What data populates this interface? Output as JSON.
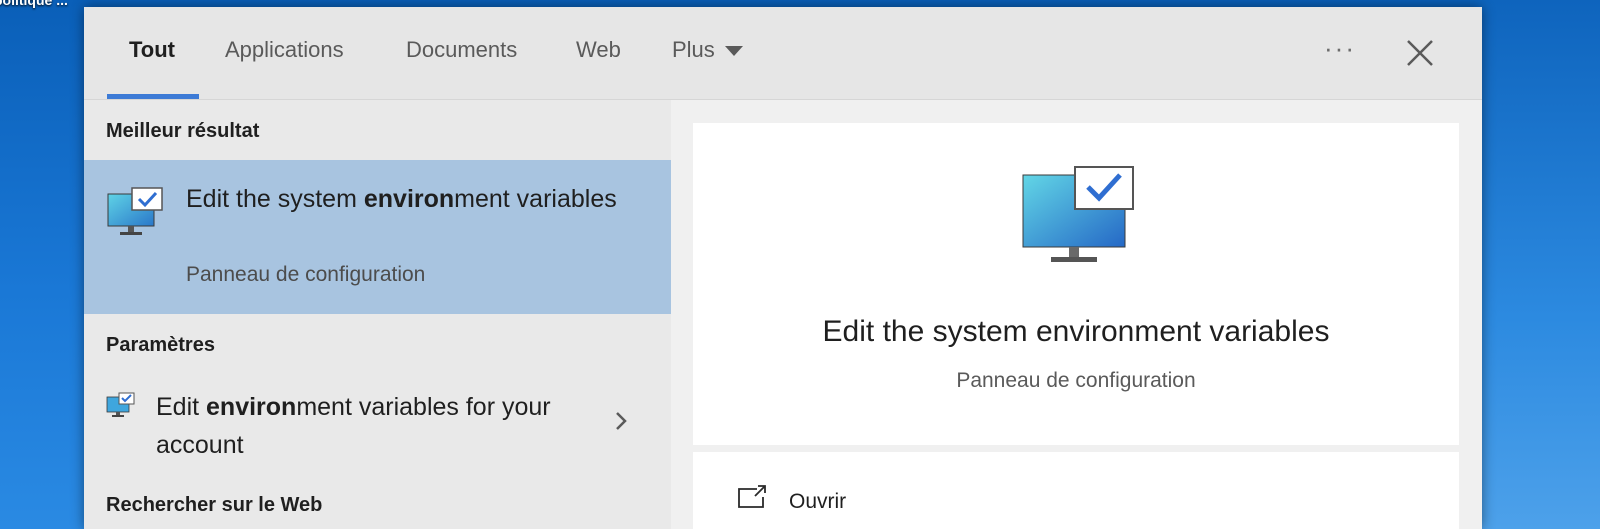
{
  "desktop": {
    "label": "politique ..."
  },
  "tabs": [
    {
      "label": "Tout",
      "active": true
    },
    {
      "label": "Applications"
    },
    {
      "label": "Documents"
    },
    {
      "label": "Web"
    },
    {
      "label": "Plus"
    }
  ],
  "header": {
    "more_icon": "ellipsis-icon",
    "close_icon": "close-icon",
    "more_label": "···"
  },
  "left": {
    "best_heading": "Meilleur résultat",
    "best": {
      "title_pre": "Edit the system ",
      "title_hl": "environ",
      "title_post": "ment variables",
      "subtitle": "Panneau de configuration",
      "icon": "system-monitor-check-icon"
    },
    "settings_heading": "Paramètres",
    "setting": {
      "title_pre": "Edit ",
      "title_hl": "environ",
      "title_post": "ment variables for your account",
      "icon": "monitor-check-icon"
    },
    "web_heading": "Rechercher sur le Web"
  },
  "preview": {
    "title": "Edit the system environment variables",
    "subtitle": "Panneau de configuration",
    "icon": "system-monitor-check-icon",
    "actions": [
      {
        "label": "Ouvrir",
        "icon": "open-window-icon"
      }
    ]
  },
  "colors": {
    "accent": "#3d7bd6",
    "selected": "#a8c4e0"
  }
}
